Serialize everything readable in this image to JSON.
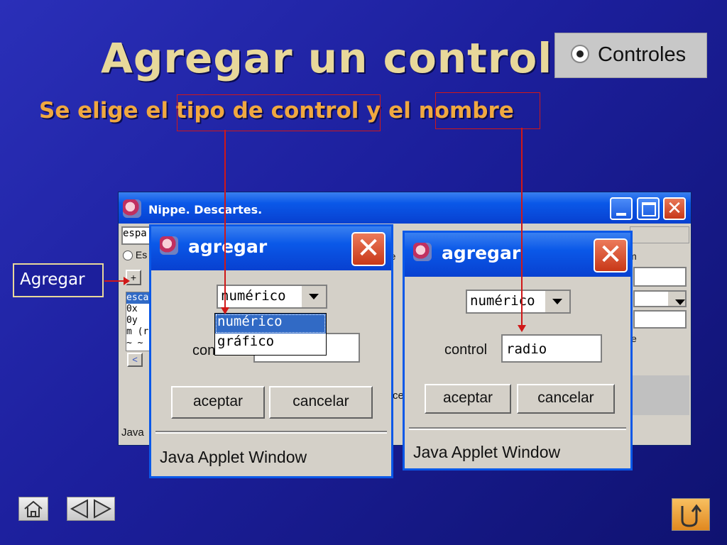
{
  "slide": {
    "title": "Agregar un control",
    "subtitle": "Se elige el tipo de control y el nombre",
    "controles_badge": "Controles",
    "agregar_callout": "Agregar"
  },
  "main_window": {
    "title": "Nippe. Descartes.",
    "field_fragment": "espa",
    "radio_fragment": "Es",
    "plus_button": "+",
    "list_items": [
      "esca",
      "0x",
      "0y",
      "m (r",
      "~ ~"
    ],
    "scroll_left": "<",
    "right_fragments": [
      "re",
      "m",
      "e"
    ],
    "bottom_left_fragment": "Java",
    "bottom_mid_fragment": "ce"
  },
  "dialog_left": {
    "title": "agregar",
    "type_select_value": "numérico",
    "dropdown_options": [
      "numérico",
      "gráfico"
    ],
    "control_label": "con",
    "accept_button": "aceptar",
    "cancel_button": "cancelar",
    "status": "Java Applet Window"
  },
  "dialog_right": {
    "title": "agregar",
    "type_select_value": "numérico",
    "control_label": "control",
    "control_value": "radio",
    "accept_button": "aceptar",
    "cancel_button": "cancelar",
    "status": "Java Applet Window"
  },
  "colors": {
    "background": "#1c1f9c",
    "title": "#e8d89a",
    "subtitle": "#f0a840",
    "highlight": "#d01818",
    "xp_title": "#0a58e8"
  },
  "nav_icons": [
    "home-icon",
    "previous-icon",
    "next-icon",
    "return-icon"
  ]
}
